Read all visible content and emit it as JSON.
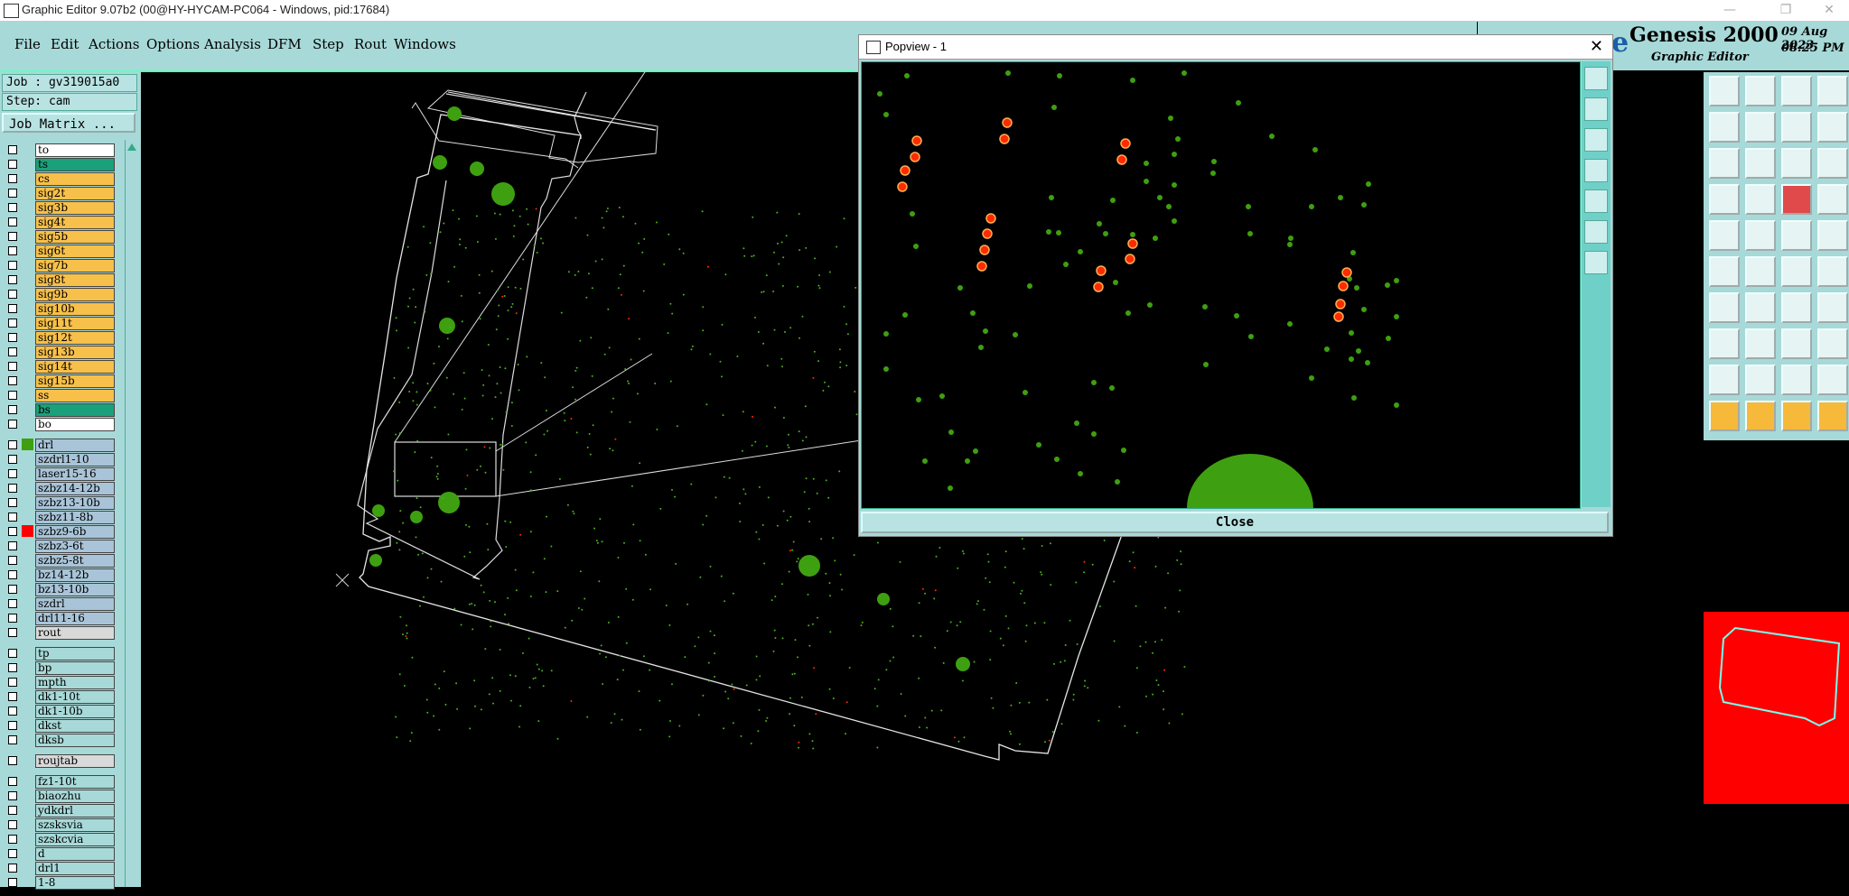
{
  "titlebar": {
    "title": "Graphic Editor 9.07b2 (00@HY-HYCAM-PC064 - Windows, pid:17684)",
    "minimize": "—",
    "maximize": "❐",
    "close": "✕"
  },
  "menu": [
    {
      "label": "File"
    },
    {
      "label": "Edit"
    },
    {
      "label": "Actions"
    },
    {
      "label": "Options"
    },
    {
      "label": "Analysis"
    },
    {
      "label": "DFM"
    },
    {
      "label": "Step"
    },
    {
      "label": "Rout"
    },
    {
      "label": "Windows"
    }
  ],
  "logo": {
    "e": "e",
    "brand": "Genesis 2000",
    "date": "09 Aug 2023",
    "time": "08:25 PM",
    "subtitle": "Graphic Editor"
  },
  "job": {
    "job": "Job : gv319015a0",
    "step": "Step: cam",
    "matrix_button": "Job Matrix ..."
  },
  "layers_group1": [
    {
      "name": "to",
      "color": "#ffffff"
    },
    {
      "name": "ts",
      "color": "#1aa07a"
    },
    {
      "name": "cs",
      "color": "#f7c04a"
    },
    {
      "name": "sig2t",
      "color": "#f7c04a"
    },
    {
      "name": "sig3b",
      "color": "#f7c04a"
    },
    {
      "name": "sig4t",
      "color": "#f7c04a"
    },
    {
      "name": "sig5b",
      "color": "#f7c04a"
    },
    {
      "name": "sig6t",
      "color": "#f7c04a"
    },
    {
      "name": "sig7b",
      "color": "#f7c04a"
    },
    {
      "name": "sig8t",
      "color": "#f7c04a"
    },
    {
      "name": "sig9b",
      "color": "#f7c04a"
    },
    {
      "name": "sig10b",
      "color": "#f7c04a"
    },
    {
      "name": "sig11t",
      "color": "#f7c04a"
    },
    {
      "name": "sig12t",
      "color": "#f7c04a"
    },
    {
      "name": "sig13b",
      "color": "#f7c04a"
    },
    {
      "name": "sig14t",
      "color": "#f7c04a"
    },
    {
      "name": "sig15b",
      "color": "#f7c04a"
    },
    {
      "name": "ss",
      "color": "#f7c04a"
    },
    {
      "name": "bs",
      "color": "#1aa07a"
    },
    {
      "name": "bo",
      "color": "#ffffff"
    }
  ],
  "layers_group2": [
    {
      "name": "drl",
      "color": "#a9c4d8",
      "swatch": "#3ea010"
    },
    {
      "name": "szdrl1-10",
      "color": "#a9c4d8"
    },
    {
      "name": "laser15-16",
      "color": "#a9c4d8"
    },
    {
      "name": "szbz14-12b",
      "color": "#a9c4d8"
    },
    {
      "name": "szbz13-10b",
      "color": "#a9c4d8"
    },
    {
      "name": "szbz11-8b",
      "color": "#a9c4d8"
    },
    {
      "name": "szbz9-6b",
      "color": "#a9c4d8",
      "swatch": "#ff0000"
    },
    {
      "name": "szbz3-6t",
      "color": "#a9c4d8"
    },
    {
      "name": "szbz5-8t",
      "color": "#a9c4d8"
    },
    {
      "name": "bz14-12b",
      "color": "#a9c4d8"
    },
    {
      "name": "bz13-10b",
      "color": "#a9c4d8"
    },
    {
      "name": "szdrl",
      "color": "#a9c4d8"
    },
    {
      "name": "drl11-16",
      "color": "#a9c4d8"
    },
    {
      "name": "rout",
      "color": "#d9d9d9"
    }
  ],
  "layers_group3": [
    {
      "name": "tp",
      "color": "#a7d9d8"
    },
    {
      "name": "bp",
      "color": "#a7d9d8"
    },
    {
      "name": "mpth",
      "color": "#a7d9d8"
    },
    {
      "name": "dk1-10t",
      "color": "#a7d9d8"
    },
    {
      "name": "dk1-10b",
      "color": "#a7d9d8"
    },
    {
      "name": "dkst",
      "color": "#a7d9d8"
    },
    {
      "name": "dksb",
      "color": "#a7d9d8"
    }
  ],
  "layers_group4": [
    {
      "name": "roujtab",
      "color": "#d9d9d9"
    }
  ],
  "layers_group5": [
    {
      "name": "fz1-10t",
      "color": "#a7d9d8"
    },
    {
      "name": "biaozhu",
      "color": "#a7d9d8"
    },
    {
      "name": "ydkdrl",
      "color": "#a7d9d8"
    },
    {
      "name": "szsksvia",
      "color": "#a7d9d8"
    },
    {
      "name": "szskcvia",
      "color": "#a7d9d8"
    },
    {
      "name": "d",
      "color": "#a7d9d8"
    },
    {
      "name": "drl1",
      "color": "#a7d9d8"
    },
    {
      "name": "1-8",
      "color": "#a7d9d8"
    }
  ],
  "popview": {
    "title": "Popview - 1",
    "close_label": "Close",
    "close_x": "✕"
  },
  "colors": {
    "accent": "#a7d9d8",
    "drill": "#3ea010",
    "highlight": "#ff2a00",
    "thumb_bg": "#ff0000"
  }
}
